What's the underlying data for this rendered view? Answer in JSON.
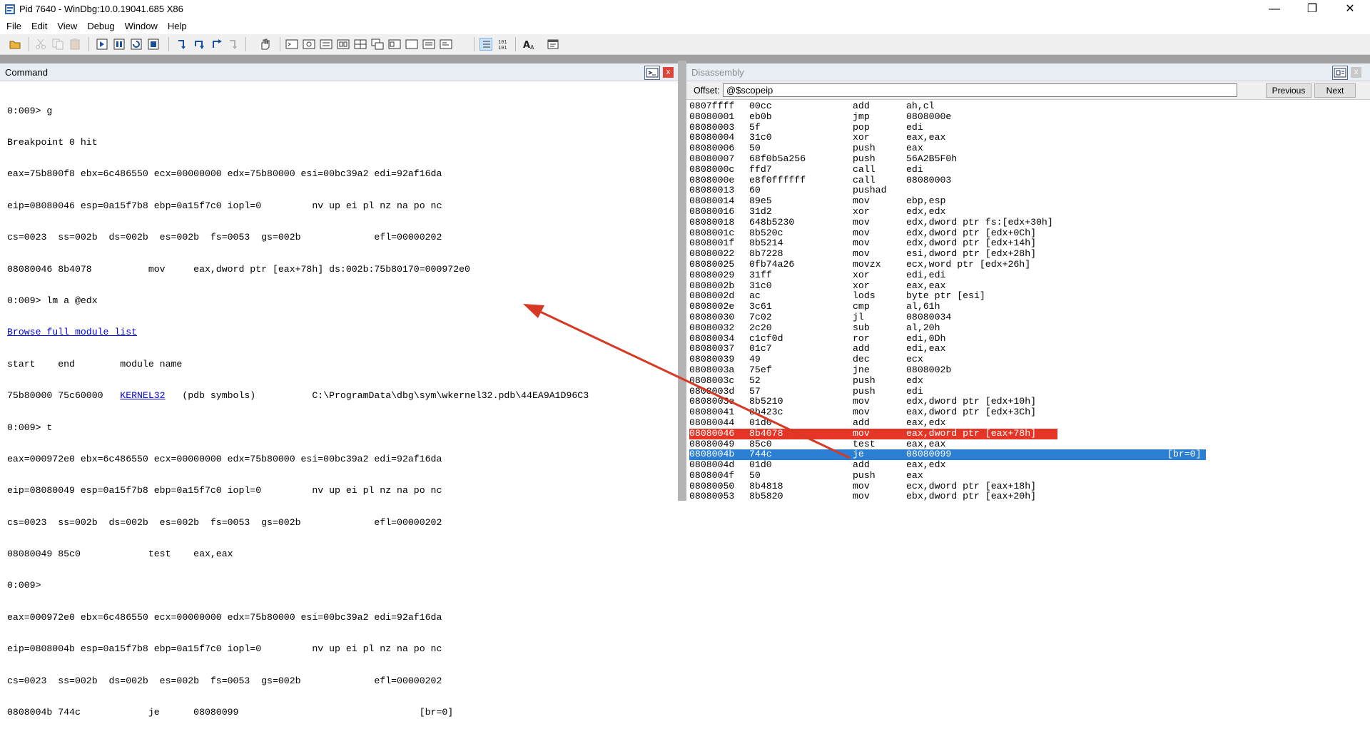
{
  "window": {
    "title": "Pid 7640 - WinDbg:10.0.19041.685 X86",
    "minimize_glyph": "—",
    "maximize_glyph": "❐",
    "close_glyph": "✕"
  },
  "menu": [
    "File",
    "Edit",
    "View",
    "Debug",
    "Window",
    "Help"
  ],
  "toolbar_icons": [
    "open-icon",
    "cut-icon",
    "copy-icon",
    "paste-icon",
    "go-icon",
    "break-icon",
    "restart-icon",
    "stop-icon",
    "step-into-icon",
    "step-over-icon",
    "step-out-icon",
    "run-to-cursor-icon",
    "hand-icon",
    "command-window-icon",
    "watch-icon",
    "locals-icon",
    "registers-icon",
    "memory-icon",
    "call-stack-icon",
    "disassembly-icon",
    "scratch-pad-icon",
    "processes-icon",
    "source-mode-icon",
    "hex-mode-icon",
    "font-icon",
    "options-icon"
  ],
  "command": {
    "title": "Command",
    "close": "x",
    "lines": [
      "0:009> g",
      "Breakpoint 0 hit",
      "eax=75b800f8 ebx=6c486550 ecx=00000000 edx=75b80000 esi=00bc39a2 edi=92af16da",
      "eip=08080046 esp=0a15f7b8 ebp=0a15f7c0 iopl=0         nv up ei pl nz na po nc",
      "cs=0023  ss=002b  ds=002b  es=002b  fs=0053  gs=002b             efl=00000202",
      "08080046 8b4078          mov     eax,dword ptr [eax+78h] ds:002b:75b80170=000972e0",
      "0:009> lm a @edx"
    ],
    "link": "Browse full module list",
    "module_header": "start    end        module name",
    "module_prefix": "75b80000 75c60000   ",
    "module_link": "KERNEL32",
    "module_suffix": "   (pdb symbols)          C:\\ProgramData\\dbg\\sym\\wkernel32.pdb\\44EA9A1D96C3",
    "lines2": [
      "0:009> t",
      "eax=000972e0 ebx=6c486550 ecx=00000000 edx=75b80000 esi=00bc39a2 edi=92af16da",
      "eip=08080049 esp=0a15f7b8 ebp=0a15f7c0 iopl=0         nv up ei pl nz na po nc",
      "cs=0023  ss=002b  ds=002b  es=002b  fs=0053  gs=002b             efl=00000202",
      "08080049 85c0            test    eax,eax",
      "0:009>",
      "eax=000972e0 ebx=6c486550 ecx=00000000 edx=75b80000 esi=00bc39a2 edi=92af16da",
      "eip=0808004b esp=0a15f7b8 ebp=0a15f7c0 iopl=0         nv up ei pl nz na po nc",
      "cs=0023  ss=002b  ds=002b  es=002b  fs=0053  gs=002b             efl=00000202",
      "0808004b 744c            je      08080099                                [br=0]"
    ]
  },
  "disassembly": {
    "title": "Disassembly",
    "close": "x",
    "offset_label": "Offset:",
    "offset_value": "@$scopeip",
    "previous": "Previous",
    "next": "Next",
    "rows": [
      [
        "0807ffff",
        "00cc",
        "add",
        "ah,cl",
        ""
      ],
      [
        "08080001",
        "eb0b",
        "jmp",
        "0808000e",
        ""
      ],
      [
        "08080003",
        "5f",
        "pop",
        "edi",
        ""
      ],
      [
        "08080004",
        "31c0",
        "xor",
        "eax,eax",
        ""
      ],
      [
        "08080006",
        "50",
        "push",
        "eax",
        ""
      ],
      [
        "08080007",
        "68f0b5a256",
        "push",
        "56A2B5F0h",
        ""
      ],
      [
        "0808000c",
        "ffd7",
        "call",
        "edi",
        ""
      ],
      [
        "0808000e",
        "e8f0ffffff",
        "call",
        "08080003",
        ""
      ],
      [
        "08080013",
        "60",
        "pushad",
        "",
        ""
      ],
      [
        "08080014",
        "89e5",
        "mov",
        "ebp,esp",
        ""
      ],
      [
        "08080016",
        "31d2",
        "xor",
        "edx,edx",
        ""
      ],
      [
        "08080018",
        "648b5230",
        "mov",
        "edx,dword ptr fs:[edx+30h]",
        ""
      ],
      [
        "0808001c",
        "8b520c",
        "mov",
        "edx,dword ptr [edx+0Ch]",
        ""
      ],
      [
        "0808001f",
        "8b5214",
        "mov",
        "edx,dword ptr [edx+14h]",
        ""
      ],
      [
        "08080022",
        "8b7228",
        "mov",
        "esi,dword ptr [edx+28h]",
        ""
      ],
      [
        "08080025",
        "0fb74a26",
        "movzx",
        "ecx,word ptr [edx+26h]",
        ""
      ],
      [
        "08080029",
        "31ff",
        "xor",
        "edi,edi",
        ""
      ],
      [
        "0808002b",
        "31c0",
        "xor",
        "eax,eax",
        ""
      ],
      [
        "0808002d",
        "ac",
        "lods",
        "byte ptr [esi]",
        ""
      ],
      [
        "0808002e",
        "3c61",
        "cmp",
        "al,61h",
        ""
      ],
      [
        "08080030",
        "7c02",
        "jl",
        "08080034",
        ""
      ],
      [
        "08080032",
        "2c20",
        "sub",
        "al,20h",
        ""
      ],
      [
        "08080034",
        "c1cf0d",
        "ror",
        "edi,0Dh",
        ""
      ],
      [
        "08080037",
        "01c7",
        "add",
        "edi,eax",
        ""
      ],
      [
        "08080039",
        "49",
        "dec",
        "ecx",
        ""
      ],
      [
        "0808003a",
        "75ef",
        "jne",
        "0808002b",
        ""
      ],
      [
        "0808003c",
        "52",
        "push",
        "edx",
        ""
      ],
      [
        "0808003d",
        "57",
        "push",
        "edi",
        ""
      ],
      [
        "0808003e",
        "8b5210",
        "mov",
        "edx,dword ptr [edx+10h]",
        ""
      ],
      [
        "08080041",
        "8b423c",
        "mov",
        "eax,dword ptr [edx+3Ch]",
        ""
      ],
      [
        "08080044",
        "01d0",
        "add",
        "eax,edx",
        ""
      ],
      [
        "08080046",
        "8b4078",
        "mov",
        "eax,dword ptr [eax+78h]",
        ""
      ],
      [
        "08080049",
        "85c0",
        "test",
        "eax,eax",
        ""
      ],
      [
        "0808004b",
        "744c",
        "je",
        "08080099",
        "[br=0]"
      ],
      [
        "0808004d",
        "01d0",
        "add",
        "eax,edx",
        ""
      ],
      [
        "0808004f",
        "50",
        "push",
        "eax",
        ""
      ],
      [
        "08080050",
        "8b4818",
        "mov",
        "ecx,dword ptr [eax+18h]",
        ""
      ],
      [
        "08080053",
        "8b5820",
        "mov",
        "ebx,dword ptr [eax+20h]",
        ""
      ]
    ],
    "breakpoint_row": 31,
    "current_row": 33
  },
  "colors": {
    "breakpoint": "#e53527",
    "current": "#2a7fd4",
    "annotation_arrow": "#d63a25"
  }
}
